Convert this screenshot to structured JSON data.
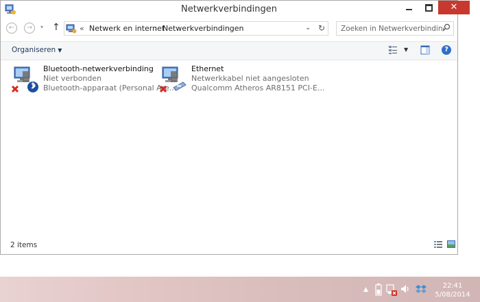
{
  "window": {
    "title": "Netwerkverbindingen"
  },
  "titlebar_buttons": {
    "close_glyph": "✕"
  },
  "navigation": {
    "back_icon": "arrow-left-icon",
    "forward_icon": "arrow-right-icon",
    "up_icon": "arrow-up-icon",
    "breadcrumb": [
      "Netwerk en internet",
      "Netwerkverbindingen"
    ],
    "breadcrumb_prefix": "«",
    "separator": "›",
    "search_placeholder": "Zoeken in Netwerkverbinding..."
  },
  "command_bar": {
    "organize_label": "Organiseren"
  },
  "items": [
    {
      "name": "Bluetooth-netwerkverbinding",
      "status": "Niet verbonden",
      "device": "Bluetooth-apparaat (Personal Are...",
      "icon": "bluetooth-network-icon",
      "error": true
    },
    {
      "name": "Ethernet",
      "status": "Netwerkkabel niet aangesloten",
      "device": "Qualcomm Atheros AR8151 PCI-E...",
      "icon": "ethernet-network-icon",
      "error": true
    }
  ],
  "status_bar": {
    "item_count": "2 items"
  },
  "taskbar": {
    "time": "22:41",
    "date": "5/08/2014"
  },
  "colors": {
    "accent": "#1e395b",
    "close": "#c7392f",
    "error": "#d42a20",
    "subtext": "#6d6d6d"
  }
}
